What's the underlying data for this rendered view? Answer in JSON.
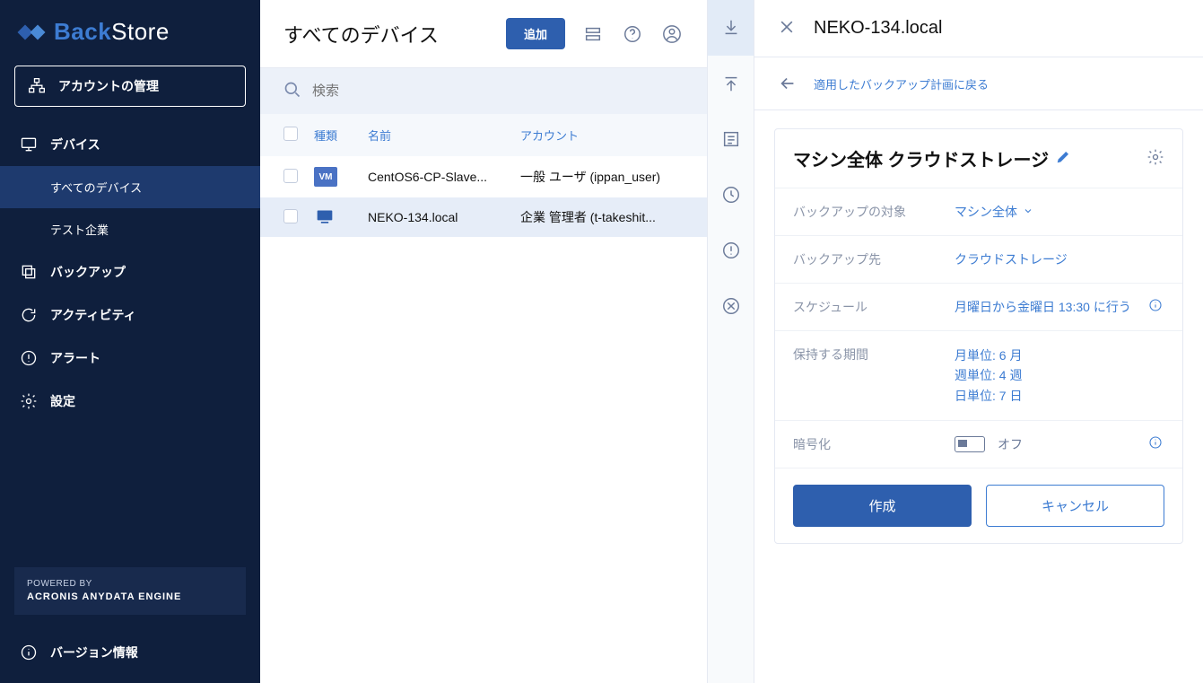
{
  "brand": {
    "part1": "Back",
    "part2": "Store"
  },
  "sidebar": {
    "account": "アカウントの管理",
    "devices": "デバイス",
    "all_devices": "すべてのデバイス",
    "test_company": "テスト企業",
    "backup": "バックアップ",
    "activity": "アクティビティ",
    "alert": "アラート",
    "settings": "設定",
    "powered_label": "POWERED BY",
    "powered_name": "ACRONIS ANYDATA ENGINE",
    "version": "バージョン情報"
  },
  "main": {
    "title": "すべてのデバイス",
    "add": "追加",
    "search_placeholder": "検索",
    "cols": {
      "type": "種類",
      "name": "名前",
      "account": "アカウント"
    },
    "rows": [
      {
        "kind": "vm",
        "kind_label": "VM",
        "name": "CentOS6-CP-Slave...",
        "account": "一般 ユーザ (ippan_user)",
        "selected": false
      },
      {
        "kind": "pc",
        "kind_label": "",
        "name": "NEKO-134.local",
        "account": "企業 管理者 (t-takeshit...",
        "selected": true
      }
    ]
  },
  "panel": {
    "title": "NEKO-134.local",
    "back": "適用したバックアップ計画に戻る",
    "card_title": "マシン全体 クラウドストレージ",
    "props": {
      "target_k": "バックアップの対象",
      "target_v": "マシン全体",
      "dest_k": "バックアップ先",
      "dest_v": "クラウドストレージ",
      "sched_k": "スケジュール",
      "sched_v": "月曜日から金曜日 13:30 に行う",
      "retain_k": "保持する期間",
      "retain_v1": "月単位: 6 月",
      "retain_v2": "週単位: 4 週",
      "retain_v3": "日単位: 7 日",
      "enc_k": "暗号化",
      "enc_v": "オフ"
    },
    "create": "作成",
    "cancel": "キャンセル"
  }
}
